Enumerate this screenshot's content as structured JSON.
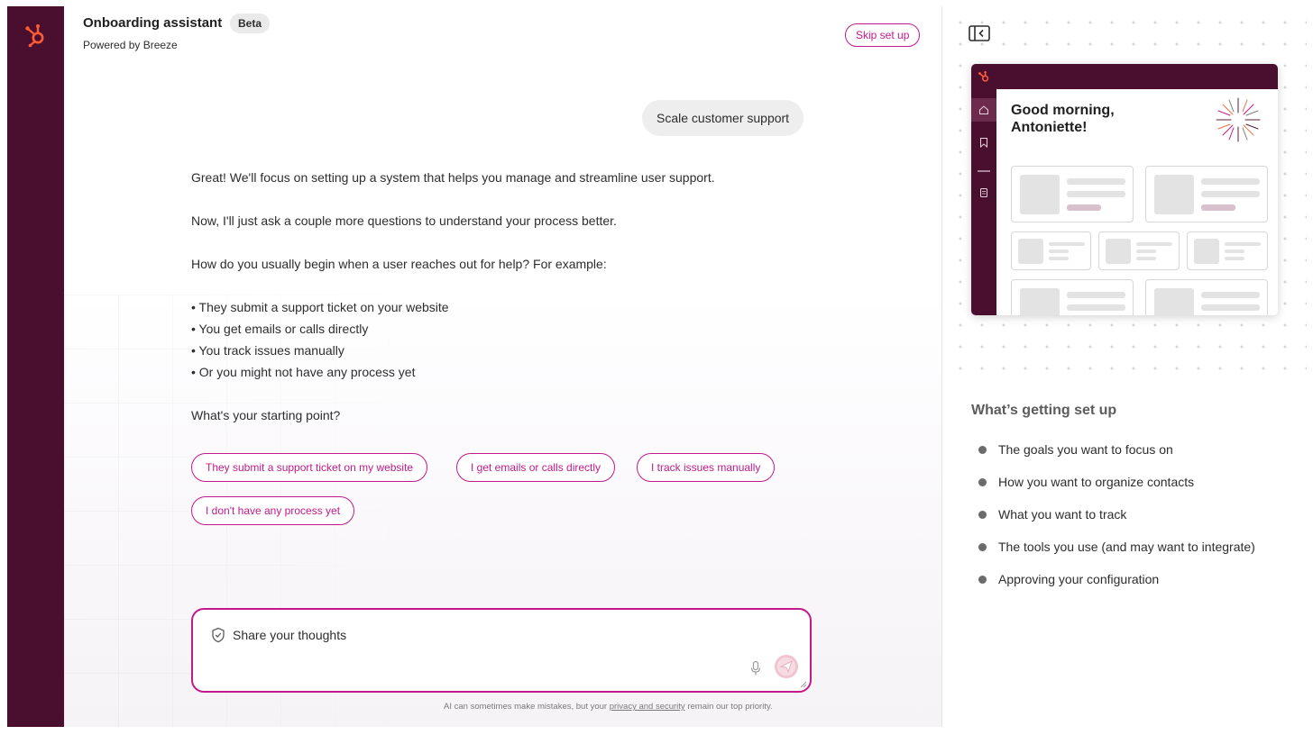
{
  "header": {
    "title": "Onboarding assistant",
    "badge": "Beta",
    "subtitle": "Powered by Breeze",
    "skip_label": "Skip set up"
  },
  "chat": {
    "user_message": "Scale customer support",
    "assistant": {
      "p1": "Great! We'll focus on setting up a system that helps you manage and streamline user support.",
      "p2": "Now, I'll just ask a couple more questions to understand your process better.",
      "p3": "How do you usually begin when a user reaches out for help? For example:",
      "bullets": [
        "They submit a support ticket on your website",
        "You get emails or calls directly",
        "You track issues manually",
        "Or you might not have any process yet"
      ],
      "question": "What's your starting point?"
    },
    "chips": [
      "They submit a support ticket on my website",
      "I get emails or calls directly",
      "I track issues manually",
      "I don't have any process yet"
    ]
  },
  "composer": {
    "placeholder": "Share your thoughts",
    "disclaimer_prefix": "AI can sometimes make mistakes, but your ",
    "disclaimer_link": "privacy and security",
    "disclaimer_suffix": " remain our top priority."
  },
  "preview": {
    "greeting": "Good morning,\nAntoniette!"
  },
  "setup": {
    "title": "What’s getting set up",
    "items": [
      "The goals you want to focus on",
      "How you want to organize contacts",
      "What you want to track",
      "The tools you use (and may want to integrate)",
      "Approving your configuration"
    ]
  },
  "colors": {
    "rail": "#4a0f2e",
    "accent": "#c21a8a",
    "logo": "#ff5c35"
  }
}
